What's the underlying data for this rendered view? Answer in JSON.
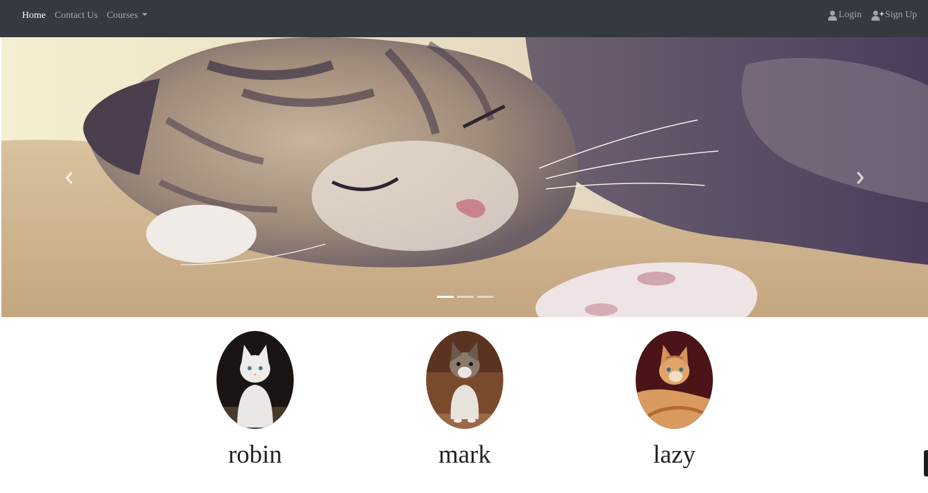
{
  "navbar": {
    "links": [
      {
        "label": "Home",
        "active": true
      },
      {
        "label": "Contact Us",
        "active": false
      },
      {
        "label": "Courses",
        "active": false,
        "has_dropdown": true
      }
    ],
    "right_links": [
      {
        "label": "Login",
        "icon": "user-icon"
      },
      {
        "label": "Sign Up",
        "icon": "user-plus-icon"
      }
    ]
  },
  "carousel": {
    "slide_count": 3,
    "active_slide": 1,
    "prev_icon": "chevron-left-icon",
    "next_icon": "chevron-right-icon"
  },
  "profiles": [
    {
      "name": "robin"
    },
    {
      "name": "mark"
    },
    {
      "name": "lazy"
    }
  ],
  "colors": {
    "navbar_bg": "#343a40",
    "nav_active": "#ffffff",
    "nav_muted": "rgba(255,255,255,0.55)"
  }
}
